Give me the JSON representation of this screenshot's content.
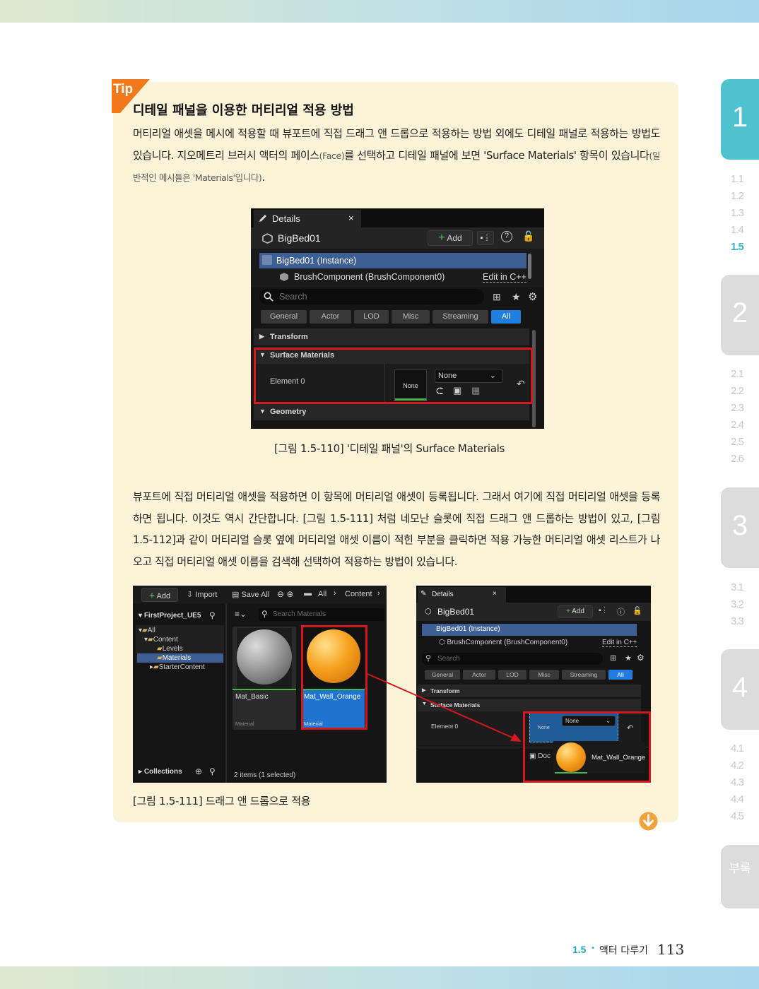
{
  "tip": {
    "badge": "Tip",
    "title": "디테일 패널을 이용한 머티리얼 적용 방법",
    "para1_main": "머티리얼 애셋을 메시에 적용할 때 뷰포트에 직접 드래그 앤 드롭으로 적용하는 방법 외에도 디테일 패널로 적용하는 방법도 있습니다. 지오메트리 브러시 액터의 페이스",
    "para1_face": "(Face)",
    "para1_mid": "를 선택하고 디테일 패널에 보면 'Surface Materials' 항목이 있습니다",
    "para1_note": "(일반적인 메시들은 'Materials'입니다)",
    "para1_end": ".",
    "para2": "뷰포트에 직접 머티리얼 애셋을 적용하면 이 항목에 머티리얼 애셋이 등록됩니다. 그래서 여기에 직접 머티리얼 애셋을 등록하면 됩니다. 이것도 역시 간단합니다. [그림 1.5-111] 처럼 네모난 슬롯에 직접 드래그 앤 드롭하는 방법이 있고, [그림 1.5-112]과 같이 머티리얼 슬롯 옆에 머티리얼 애셋 이름이 적힌 부분을 클릭하면 적용 가능한 머티리얼 애셋 리스트가 나오고 직접 머티리얼 애셋 이름을 검색해 선택하여 적용하는 방법이 있습니다.",
    "caption1": "[그림 1.5-110] '디테일 패널'의 Surface Materials",
    "caption2": "[그림 1.5-111] 드래그 앤 드롭으로 적용"
  },
  "details_panel": {
    "tab_label": "Details",
    "actor_name": "BigBed01",
    "add_label": "Add",
    "instance_label": "BigBed01 (Instance)",
    "component_label": "BrushComponent (BrushComponent0)",
    "edit_cpp": "Edit in C++",
    "search_placeholder": "Search",
    "filters": [
      "General",
      "Actor",
      "LOD",
      "Misc",
      "Streaming",
      "All"
    ],
    "transform": "Transform",
    "surface_materials": "Surface Materials",
    "element_label": "Element 0",
    "slot_none": "None",
    "dropdown_value": "None",
    "geometry": "Geometry"
  },
  "content_browser": {
    "add_label": "Add",
    "import_label": "Import",
    "save_all_label": "Save All",
    "path_all": "All",
    "path_content": "Content",
    "project_name": "FirstProject_UE5",
    "search_placeholder": "Search Materials",
    "tree": [
      "All",
      "Content",
      "Levels",
      "Materials",
      "StarterContent"
    ],
    "collections": "Collections",
    "assets": [
      {
        "name": "Mat_Basic",
        "type": "Material"
      },
      {
        "name": "Mat_Wall_Orange",
        "type": "Material"
      }
    ],
    "status": "2 items (1 selected)"
  },
  "details_small": {
    "tab_label": "Details",
    "actor_name": "BigBed01",
    "add_label": "Add",
    "instance_label": "BigBed01 (Instance)",
    "component_label": "BrushComponent (BrushComponent0)",
    "edit_cpp": "Edit in C++",
    "search_placeholder": "Search",
    "filters": [
      "General",
      "Actor",
      "LOD",
      "Misc",
      "Streaming",
      "All"
    ],
    "transform": "Transform",
    "surface_materials": "Surface Materials",
    "element_label": "Element 0",
    "slot_none": "None",
    "dropdown_value": "None",
    "doc_label": "Doc",
    "drag_asset": "Mat_Wall_Orange"
  },
  "chapters": {
    "tabs": [
      "1",
      "2",
      "3",
      "4",
      "부록"
    ],
    "ch1_sections": [
      "1.1",
      "1.2",
      "1.3",
      "1.4",
      "1.5"
    ],
    "ch2_sections": [
      "2.1",
      "2.2",
      "2.3",
      "2.4",
      "2.5",
      "2.6"
    ],
    "ch3_sections": [
      "3.1",
      "3.2",
      "3.3"
    ],
    "ch4_sections": [
      "4.1",
      "4.2",
      "4.3",
      "4.4",
      "4.5"
    ]
  },
  "footer": {
    "section": "1.5",
    "title": "액터 다루기",
    "page": "113"
  },
  "colors": {
    "accent_teal": "#4fc2cf",
    "tip_bg": "#fdf3d8",
    "tip_orange": "#f07a1a",
    "highlight_red": "#d4181e"
  }
}
